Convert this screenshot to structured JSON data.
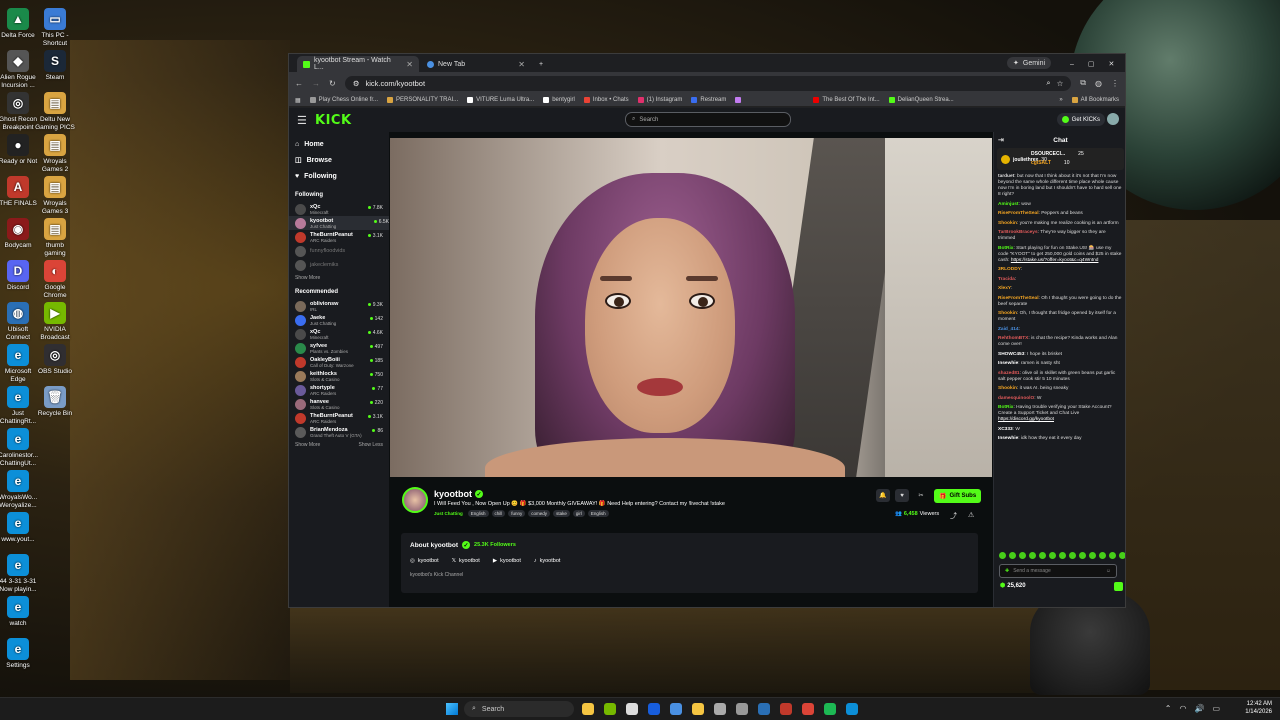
{
  "desktop": {
    "icons": [
      {
        "label": "Delta Force",
        "color": "#1a8a4a",
        "glyph": "▲"
      },
      {
        "label": "This PC - Shortcut",
        "color": "#3a7bd5",
        "glyph": "▭"
      },
      {
        "label": "Alien Rogue Incursion ...",
        "color": "#555",
        "glyph": "◆"
      },
      {
        "label": "Steam",
        "color": "#1b2838",
        "glyph": "S"
      },
      {
        "label": "Ghost Recon Breakpoint",
        "color": "#333",
        "glyph": "◎"
      },
      {
        "label": "Deltu New Gaming PICS",
        "color": "#d9a441",
        "glyph": "▤"
      },
      {
        "label": "Ready or Not",
        "color": "#222",
        "glyph": "●"
      },
      {
        "label": "Wroyals Games 2",
        "color": "#d9a441",
        "glyph": "▤"
      },
      {
        "label": "THE FINALS",
        "color": "#c0392b",
        "glyph": "A"
      },
      {
        "label": "Wroyals Games 3",
        "color": "#d9a441",
        "glyph": "▤"
      },
      {
        "label": "Bodycam",
        "color": "#8b1a1a",
        "glyph": "◉"
      },
      {
        "label": "thumb gaming",
        "color": "#d9a441",
        "glyph": "▤"
      },
      {
        "label": "Discord",
        "color": "#5865f2",
        "glyph": "D"
      },
      {
        "label": "Google Chrome",
        "color": "#db4437",
        "glyph": "◐"
      },
      {
        "label": "Ubisoft Connect",
        "color": "#2a6fb5",
        "glyph": "◍"
      },
      {
        "label": "NVIDIA Broadcast",
        "color": "#76b900",
        "glyph": "▶"
      },
      {
        "label": "Microsoft Edge",
        "color": "#0c8fd8",
        "glyph": "e"
      },
      {
        "label": "OBS Studio",
        "color": "#302e31",
        "glyph": "◎"
      },
      {
        "label": "Just ChattingRt...",
        "color": "#0c8fd8",
        "glyph": "e"
      },
      {
        "label": "Recycle Bin",
        "color": "#7a9cc6",
        "glyph": "🗑"
      },
      {
        "label": "Carolinestor... ChattingUt...",
        "color": "#0c8fd8",
        "glyph": "e"
      },
      {
        "label": "WroyalsWo... Weroyalize...",
        "color": "#0c8fd8",
        "glyph": "e"
      },
      {
        "label": "www.yout...",
        "color": "#0c8fd8",
        "glyph": "e"
      },
      {
        "label": "44 3-31 3-31 Now playin...",
        "color": "#0c8fd8",
        "glyph": "e"
      },
      {
        "label": "watch",
        "color": "#0c8fd8",
        "glyph": "e"
      },
      {
        "label": "Settings",
        "color": "#0c8fd8",
        "glyph": "e"
      }
    ]
  },
  "browser": {
    "tabs": [
      {
        "label": "kyootbot Stream - Watch L...",
        "favicon_color": "#53fc18"
      },
      {
        "label": "New Tab",
        "favicon_color": "#4a90e2"
      }
    ],
    "new_tab_symbol": "+",
    "gemini_label": "Gemini",
    "window_controls": [
      "–",
      "▢",
      "✕"
    ],
    "url": "kick.com/kyootbot",
    "bookmarks": [
      {
        "label": "Play Chess Online fr...",
        "color": "#999"
      },
      {
        "label": "PERSONALITY TRAI...",
        "color": "#d9a441"
      },
      {
        "label": "VITURE Luma Ultra...",
        "color": "#fff"
      },
      {
        "label": "bentygirl",
        "color": "#fff"
      },
      {
        "label": "Inbox • Chats",
        "color": "#ea4335"
      },
      {
        "label": "(1) Instagram",
        "color": "#e1306c"
      },
      {
        "label": "Restream",
        "color": "#3a6df0"
      },
      {
        "label": "",
        "color": "#c27cf0"
      },
      {
        "label": "The Best Of The Int...",
        "color": "#e00"
      },
      {
        "label": "DelianQueen Strea...",
        "color": "#53fc18"
      }
    ],
    "all_bookmarks": "All Bookmarks"
  },
  "kick": {
    "logo": "KICK",
    "search_placeholder": "Search",
    "get_kicks": "Get KICKs",
    "nav": [
      {
        "label": "Home",
        "icon": "home-icon",
        "glyph": "⌂"
      },
      {
        "label": "Browse",
        "icon": "browse-icon",
        "glyph": "◫"
      },
      {
        "label": "Following",
        "icon": "heart-icon",
        "glyph": "♥"
      }
    ],
    "following_title": "Following",
    "following": [
      {
        "name": "xQc",
        "sub": "Minecraft",
        "viewers": "7.8K",
        "color": "#4a4a4a",
        "dim": false,
        "active": false
      },
      {
        "name": "kyootbot",
        "sub": "Just Chatting",
        "viewers": "6.5K",
        "color": "#b77a9a",
        "dim": false,
        "active": true
      },
      {
        "name": "TheBurntPeanut",
        "sub": "ARC Raiders",
        "viewers": "3.1K",
        "color": "#c0392b",
        "dim": false,
        "active": false
      },
      {
        "name": "funnyfloodvids",
        "sub": "",
        "viewers": "",
        "color": "#555",
        "dim": true,
        "active": false
      },
      {
        "name": "jakeclemiks",
        "sub": "",
        "viewers": "",
        "color": "#555",
        "dim": true,
        "active": false
      }
    ],
    "show_more": "Show More",
    "recommended_title": "Recommended",
    "recommended": [
      {
        "name": "oblivionsw",
        "sub": "IRL",
        "viewers": "9.3K",
        "color": "#7a6a5a"
      },
      {
        "name": "Jaeke",
        "sub": "Just Chatting",
        "viewers": "142",
        "color": "#3a6df0"
      },
      {
        "name": "xQc",
        "sub": "Minecraft",
        "viewers": "4.6K",
        "color": "#4a4a4a"
      },
      {
        "name": "syfvee",
        "sub": "Plants vs. Zombies",
        "viewers": "497",
        "color": "#2a8a4a"
      },
      {
        "name": "OakleyBoiii",
        "sub": "Call of Duty: Warzone",
        "viewers": "185",
        "color": "#c0392b"
      },
      {
        "name": "keithlocks",
        "sub": "Slots & Casino",
        "viewers": "750",
        "color": "#9a7a5a"
      },
      {
        "name": "shortyple",
        "sub": "ARC Raiders",
        "viewers": "77",
        "color": "#6a5a9a"
      },
      {
        "name": "hanvee",
        "sub": "Slots & Casino",
        "viewers": "220",
        "color": "#9a6a7a"
      },
      {
        "name": "TheBurntPeanut",
        "sub": "ARC Raiders",
        "viewers": "3.1K",
        "color": "#c0392b"
      },
      {
        "name": "BrianMendoza",
        "sub": "Grand Theft Auto V (GTA)",
        "viewers": "86",
        "color": "#5a5a5a"
      }
    ],
    "show_less": "Show Less",
    "stream": {
      "username": "kyootbot",
      "title": "I Will Feed You , Now Open Up 😊 🎁 $3,000 Monthly GIVEAWAY! 🎁 Need Help entering? Contact my !livechat !stake",
      "category": "Just Chatting",
      "tags": [
        "English",
        "chill",
        "funny",
        "comedy",
        "stake",
        "girl",
        "English"
      ],
      "gift_subs": "Gift Subs",
      "viewers": "6,458",
      "viewers_label": "Viewers"
    },
    "about": {
      "heading": "About kyootbot",
      "followers": "25.3K Followers",
      "socials": [
        {
          "platform": "instagram-icon",
          "glyph": "◎",
          "handle": "kyootbot"
        },
        {
          "platform": "x-icon",
          "glyph": "𝕏",
          "handle": "kyootbot"
        },
        {
          "platform": "youtube-icon",
          "glyph": "▶",
          "handle": "kyootbot"
        },
        {
          "platform": "tiktok-icon",
          "glyph": "♪",
          "handle": "kyootbot"
        }
      ],
      "description": "kyootbot's Kick Channel"
    },
    "chat": {
      "title": "Chat",
      "leaders": [
        {
          "name": "jouliethrex",
          "count": "30",
          "x": 0
        },
        {
          "name": "DSOURCECI...",
          "count": "25",
          "x": 1
        },
        {
          "name": "cgiSALT",
          "count": "10",
          "x": 2
        }
      ],
      "messages": [
        {
          "user": "tarduet",
          "color": "#ddd",
          "text": "but now that I think about it it's not that I'm now beyond the same whole different time place whole cause now I'm in boring land but I shouldn't have to hard sell one 8 right?"
        },
        {
          "user": "Aminjust",
          "color": "#53fc18",
          "text": "wow"
        },
        {
          "user": "RiseFromTheSeal",
          "color": "#f5a623",
          "text": "Peppers and beans"
        },
        {
          "user": "Shookin",
          "color": "#f5a623",
          "text": "you're making me realize cooking is an artform"
        },
        {
          "user": "TarBrookBraceys",
          "color": "#e05a5a",
          "text": "They're way bigger so they are trimmed"
        },
        {
          "user": "BotRix",
          "color": "#53fc18",
          "text": "Start playing for fun on Stake.US! 🎰 use my code \"KYOOT\" to get 250,000 gold coins and $25 in stake cash:",
          "link": "https://stake.us/?offer=kyoot&c=q4Wntnd"
        },
        {
          "user": "3RLODDY",
          "color": "#f5a623",
          "text": ""
        },
        {
          "user": "Tracida",
          "color": "#e05a5a",
          "text": ""
        },
        {
          "user": "XlexY",
          "color": "#f5a623",
          "text": ""
        },
        {
          "user": "RiseFromTheSeal",
          "color": "#f5a623",
          "text": "Oh I thought you were going to do the beef separate"
        },
        {
          "user": "Shookin",
          "color": "#f5a623",
          "text": "Oh, I thought that fridge opened by itself for a moment"
        },
        {
          "user": "Zaid_414",
          "color": "#4a90e2",
          "text": ""
        },
        {
          "user": "RehthomBTX",
          "color": "#e05a5a",
          "text": "is chat the recipe? Kinda works and Alan come over!"
        },
        {
          "user": "SHOWC453",
          "color": "#fff",
          "text": "I hope its brisket"
        },
        {
          "user": "Insewhie",
          "color": "#fff",
          "text": "ramen is nasty sht"
        },
        {
          "user": "shazed81",
          "color": "#e05a5a",
          "text": "olive oil in skillet with green beans put garlic salt pepper cook stir 5 10 minutes"
        },
        {
          "user": "Shookin",
          "color": "#f5a623",
          "text": "it was AI. being sneaky"
        },
        {
          "user": "damesquinoolO",
          "color": "#e05a5a",
          "text": "W"
        },
        {
          "user": "BotRix",
          "color": "#53fc18",
          "text": "Having trouble verifying your Stake Account? Create a Support Ticket and Chat Live",
          "link": "https://discord.gg/kyootbot"
        },
        {
          "user": "XC333",
          "color": "#fff",
          "text": "W"
        },
        {
          "user": "Insewhie",
          "color": "#fff",
          "text": "idk how they eat it every day"
        }
      ],
      "input_placeholder": "Send a message",
      "points": "25,620"
    }
  },
  "taskbar": {
    "search_label": "Search",
    "time": "12:42 AM",
    "date": "1/14/2026",
    "apps": [
      {
        "name": "file-explorer-icon",
        "color": "#f5c542",
        "x": 0
      },
      {
        "name": "nvidia-icon",
        "color": "#76b900",
        "x": 1
      },
      {
        "name": "app-icon",
        "color": "#ddd",
        "x": 2
      },
      {
        "name": "bitwarden-icon",
        "color": "#175ddc",
        "x": 3
      },
      {
        "name": "calculator-icon",
        "color": "#4a90e2",
        "x": 4
      },
      {
        "name": "folder-icon",
        "color": "#f5c542",
        "x": 5
      },
      {
        "name": "store-icon",
        "color": "#aaa",
        "x": 6
      },
      {
        "name": "settings-icon",
        "color": "#999",
        "x": 7
      },
      {
        "name": "steam-icon",
        "color": "#2a6fb5",
        "x": 8
      },
      {
        "name": "recorder-icon",
        "color": "#c0392b",
        "x": 9
      },
      {
        "name": "chrome-icon",
        "color": "#db4437",
        "x": 10
      },
      {
        "name": "spotify-icon",
        "color": "#1db954",
        "x": 11
      },
      {
        "name": "edge-icon",
        "color": "#0c8fd8",
        "x": 12
      }
    ]
  }
}
